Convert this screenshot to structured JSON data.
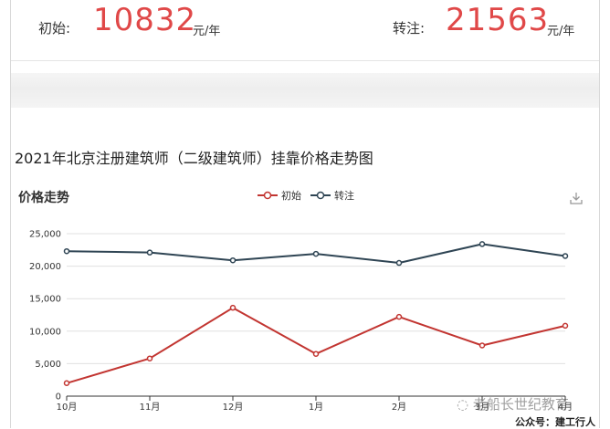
{
  "stats": {
    "left": {
      "label": "初始:",
      "value": "10832",
      "unit": "元/年"
    },
    "right": {
      "label": "转注:",
      "value": "21563",
      "unit": "元/年"
    }
  },
  "page_title": "2021年北京注册建筑师（二级建筑师）挂靠价格走势图",
  "watermark": {
    "line1": "老船长世纪教育",
    "line2": "公众号：建工行人"
  },
  "colors": {
    "series1": "#c23531",
    "series2": "#2f4554",
    "stat_value": "#e04848"
  },
  "icons": {
    "download": "download-icon"
  },
  "chart_data": {
    "type": "line",
    "title": "价格走势",
    "categories": [
      "10月",
      "11月",
      "12月",
      "1月",
      "2月",
      "3月",
      "4月"
    ],
    "series": [
      {
        "name": "初始",
        "values": [
          2000,
          5800,
          13600,
          6500,
          12200,
          7800,
          10832
        ]
      },
      {
        "name": "转注",
        "values": [
          22300,
          22100,
          20900,
          21900,
          20500,
          23400,
          21563
        ]
      }
    ],
    "ylim": [
      0,
      25000
    ],
    "yticks": [
      0,
      5000,
      10000,
      15000,
      20000,
      25000
    ],
    "ytick_labels": [
      "0",
      "5,000",
      "10,000",
      "15,000",
      "20,000",
      "25,000"
    ],
    "grid": true,
    "legend": "top-center"
  }
}
